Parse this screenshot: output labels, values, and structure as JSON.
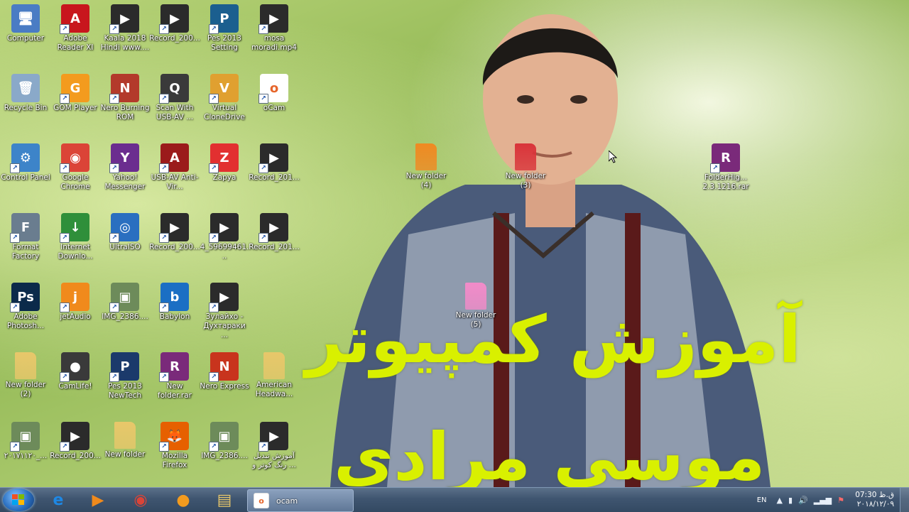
{
  "desktop": {
    "wallpaper_text_line1": "آموزش کمپیوتر",
    "wallpaper_text_line2": "موسی مرادی",
    "icons": [
      {
        "label": "Computer",
        "icon": "computer-icon",
        "color": "#4a7cc4",
        "glyph": "🖥"
      },
      {
        "label": "Adobe Reader XI",
        "icon": "adobe-reader-icon",
        "color": "#c8161d",
        "glyph": "A"
      },
      {
        "label": "Kaala 2018 Hindi www....",
        "icon": "video-file-icon",
        "color": "#2b2b2b",
        "glyph": "▶"
      },
      {
        "label": "Record_200...",
        "icon": "video-file-icon",
        "color": "#2b2b2b",
        "glyph": "▶"
      },
      {
        "label": "Pes 2013 Setting",
        "icon": "pes-settings-icon",
        "color": "#1b5f8f",
        "glyph": "P"
      },
      {
        "label": "mosa moradi.mp4",
        "icon": "video-file-icon",
        "color": "#2b2b2b",
        "glyph": "▶"
      },
      {
        "label": "Recycle Bin",
        "icon": "recycle-bin-icon",
        "color": "#8aa9c9",
        "glyph": "🗑"
      },
      {
        "label": "GOM Player",
        "icon": "gom-player-icon",
        "color": "#f39b1e",
        "glyph": "G"
      },
      {
        "label": "Nero Burning ROM",
        "icon": "nero-icon",
        "color": "#b33a2b",
        "glyph": "N"
      },
      {
        "label": "Scan With USB-AV ...",
        "icon": "scan-icon",
        "color": "#3a3a3a",
        "glyph": "Q"
      },
      {
        "label": "Virtual CloneDrive",
        "icon": "clonedrive-icon",
        "color": "#e0a030",
        "glyph": "V"
      },
      {
        "label": "oCam",
        "icon": "ocam-icon",
        "color": "#ffffff",
        "glyph": "o"
      },
      {
        "label": "Control Panel",
        "icon": "control-panel-icon",
        "color": "#3d84c9",
        "glyph": "⚙"
      },
      {
        "label": "Google Chrome",
        "icon": "chrome-icon",
        "color": "#db4437",
        "glyph": "◉"
      },
      {
        "label": "Yahoo! Messenger",
        "icon": "yahoo-messenger-icon",
        "color": "#6b2d8f",
        "glyph": "Y"
      },
      {
        "label": "USB-AV Anti-Vir...",
        "icon": "usb-av-icon",
        "color": "#9b1b1b",
        "glyph": "A"
      },
      {
        "label": "Zapya",
        "icon": "zapya-icon",
        "color": "#e23030",
        "glyph": "Z"
      },
      {
        "label": "Record_201...",
        "icon": "video-file-icon",
        "color": "#2b2b2b",
        "glyph": "▶"
      },
      {
        "label": "Format Factory",
        "icon": "format-factory-icon",
        "color": "#6a7d8f",
        "glyph": "F"
      },
      {
        "label": "Internet Downlo...",
        "icon": "idm-icon",
        "color": "#2f8f3a",
        "glyph": "↓"
      },
      {
        "label": "UltraISO",
        "icon": "ultraiso-icon",
        "color": "#2a6fc0",
        "glyph": "◎"
      },
      {
        "label": "Record_200...",
        "icon": "video-file-icon",
        "color": "#2b2b2b",
        "glyph": "▶"
      },
      {
        "label": "4_59699461...",
        "icon": "video-file-icon",
        "color": "#2b2b2b",
        "glyph": "▶"
      },
      {
        "label": "Record_201...",
        "icon": "video-file-icon",
        "color": "#2b2b2b",
        "glyph": "▶"
      },
      {
        "label": "Adobe Photosh...",
        "icon": "photoshop-icon",
        "color": "#0b2a4a",
        "glyph": "Ps"
      },
      {
        "label": "jetAudio",
        "icon": "jetaudio-icon",
        "color": "#f08a1c",
        "glyph": "j"
      },
      {
        "label": "IMG_2386....",
        "icon": "image-file-icon",
        "color": "#6d8b5a",
        "glyph": "▣"
      },
      {
        "label": "Babylon",
        "icon": "babylon-icon",
        "color": "#1b6fc4",
        "glyph": "b"
      },
      {
        "label": "Зулайхо - Духтараки ...",
        "icon": "video-file-icon",
        "color": "#2b2b2b",
        "glyph": "▶"
      },
      {
        "label": "New folder (2)",
        "icon": "folder-icon",
        "color": "#e8c76a",
        "glyph": ""
      },
      {
        "label": "CamLife!",
        "icon": "camlife-icon",
        "color": "#3a3a3a",
        "glyph": "●"
      },
      {
        "label": "Pes 2013 NewTech",
        "icon": "pes-icon",
        "color": "#1b3a6b",
        "glyph": "P"
      },
      {
        "label": "New folder.rar",
        "icon": "winrar-icon",
        "color": "#7a2a7a",
        "glyph": "R"
      },
      {
        "label": "Nero Express",
        "icon": "nero-express-icon",
        "color": "#c8341d",
        "glyph": "N"
      },
      {
        "label": "American Headwa...",
        "icon": "zip-folder-icon",
        "color": "#e8c76a",
        "glyph": ""
      },
      {
        "label": "۲۰۱۷۱۱۲۰_...",
        "icon": "image-file-icon",
        "color": "#6d8b5a",
        "glyph": "▣"
      },
      {
        "label": "Record_200...",
        "icon": "video-file-icon",
        "color": "#2b2b2b",
        "glyph": "▶"
      },
      {
        "label": "New folder",
        "icon": "folder-icon",
        "color": "#e8c76a",
        "glyph": ""
      },
      {
        "label": "Mozilla Firefox",
        "icon": "firefox-icon",
        "color": "#e66000",
        "glyph": "🦊"
      },
      {
        "label": "IMG_2386....",
        "icon": "image-file-icon",
        "color": "#6d8b5a",
        "glyph": "▣"
      },
      {
        "label": "آموزش تبدیل رنگ کوتر و ...",
        "icon": "video-file-icon",
        "color": "#2b2b2b",
        "glyph": "▶"
      },
      {
        "label": "New folder (4)",
        "icon": "folder-orange-icon",
        "color": "#ef8a22",
        "glyph": ""
      },
      {
        "label": "New folder (3)",
        "icon": "folder-red-icon",
        "color": "#d9343a",
        "glyph": ""
      },
      {
        "label": "FolderHig... 2.3.1216.rar",
        "icon": "winrar-icon",
        "color": "#7a2a7a",
        "glyph": "R"
      },
      {
        "label": "New folder (5)",
        "icon": "folder-pink-icon",
        "color": "#f28bc9",
        "glyph": ""
      }
    ]
  },
  "taskbar": {
    "start_label": "Start",
    "pinned": [
      {
        "name": "internet-explorer-icon",
        "glyph": "e",
        "color": "#1e88e5"
      },
      {
        "name": "media-player-icon",
        "glyph": "▶",
        "color": "#f08a1c"
      },
      {
        "name": "chrome-icon",
        "glyph": "◉",
        "color": "#db4437"
      },
      {
        "name": "gom-player-icon",
        "glyph": "●",
        "color": "#f39b1e"
      },
      {
        "name": "explorer-icon",
        "glyph": "▤",
        "color": "#e8c76a"
      }
    ],
    "active_task": "ocam",
    "language": "EN",
    "time": "07:30 ق.ظ",
    "date": "۲۰۱۸/۱۲/۰۹"
  }
}
